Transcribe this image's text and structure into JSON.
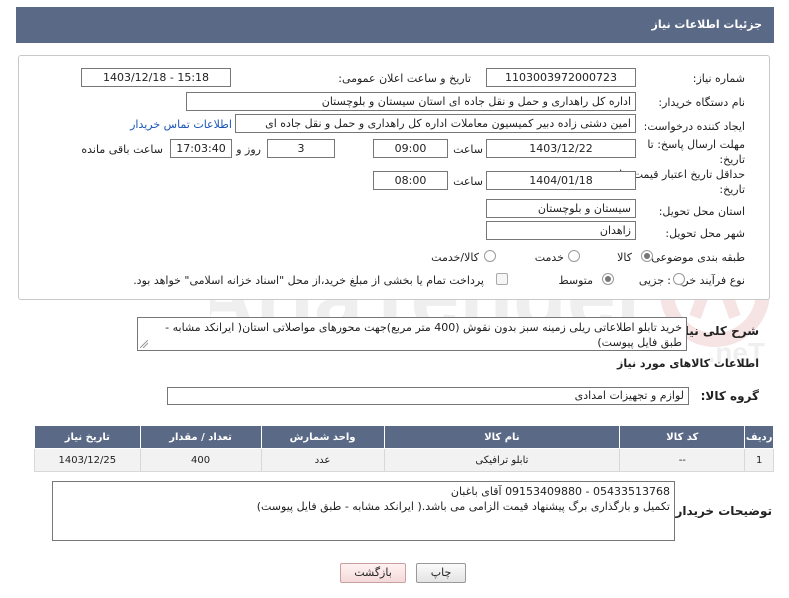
{
  "header": {
    "title": "جزئیات اطلاعات نیاز"
  },
  "fields": {
    "need_number_label": "شماره نیاز:",
    "need_number": "1103003972000723",
    "announce_label": "تاریخ و ساعت اعلان عمومی:",
    "announce_value": "1403/12/18 - 15:18",
    "buyer_label": "نام دستگاه خریدار:",
    "buyer_value": "اداره کل راهداری و حمل و نقل جاده ای استان سیستان و بلوچستان",
    "creator_label": "ایجاد کننده درخواست:",
    "creator_value": "امین دشتی زاده دبیر کمیسیون معاملات اداره کل راهداری و حمل و نقل جاده ای",
    "contact_link": "اطلاعات تماس خریدار",
    "deadline_label_1": "مهلت ارسال پاسخ: تا",
    "deadline_label_2": "تاریخ:",
    "deadline_date": "1403/12/22",
    "time_label": "ساعت",
    "deadline_time": "09:00",
    "days_value": "3",
    "days_label": "روز و",
    "remaining_time": "17:03:40",
    "remaining_label": "ساعت باقی مانده",
    "validity_label_1": "حداقل تاریخ اعتبار قیمت: تا",
    "validity_label_2": "تاریخ:",
    "validity_date": "1404/01/18",
    "validity_time": "08:00",
    "province_label": "استان محل تحویل:",
    "province_value": "سیستان و بلوچستان",
    "city_label": "شهر محل تحویل:",
    "city_value": "زاهدان",
    "category_label": "طبقه بندی موضوعی:",
    "category_options": [
      "کالا",
      "خدمت",
      "کالا/خدمت"
    ],
    "process_label": "نوع فرآیند خرید :",
    "process_options": [
      "جزیی",
      "متوسط"
    ],
    "payment_note": "پرداخت تمام یا بخشی از مبلغ خرید،از محل \"اسناد خزانه اسلامی\" خواهد بود."
  },
  "description": {
    "label": "شرح کلی نیاز:",
    "text": "خرید تابلو اطلاعاتی ریلی زمینه سبز بدون نقوش (400 متر مربع)جهت محورهای مواصلاتی استان( ایرانکد مشابه - طبق فایل پیوست)"
  },
  "goods_section": {
    "title": "اطلاعات کالاهای مورد نیاز",
    "group_label": "گروه کالا:",
    "group_value": "لوازم و تجهیزات امدادی"
  },
  "table": {
    "headers": [
      "ردیف",
      "کد کالا",
      "نام کالا",
      "واحد شمارش",
      "تعداد / مقدار",
      "تاریخ نیاز"
    ],
    "rows": [
      [
        "1",
        "--",
        "تابلو ترافیکی",
        "عدد",
        "400",
        "1403/12/25"
      ]
    ]
  },
  "buyer_notes": {
    "label": "توضیحات خریدار:",
    "line1": "05433513768 - 09153409880 آقای باغبان",
    "line2": "تکمیل و بارگذاری برگ پیشنهاد قیمت الزامی می باشد.( ایرانکد مشابه - طبق فایل پیوست)"
  },
  "buttons": {
    "print": "چاپ",
    "back": "بازگشت"
  },
  "colors": {
    "header": "#5a6a86",
    "link": "#1a55b8",
    "back_button": "#f4d9d9"
  }
}
